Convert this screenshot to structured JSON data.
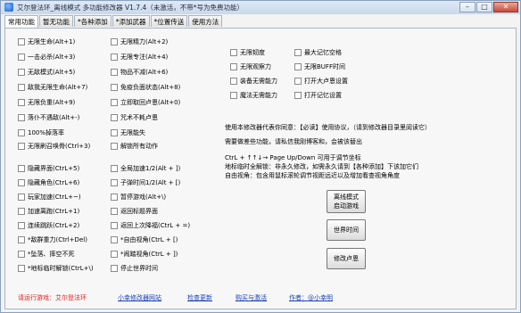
{
  "window": {
    "title": "艾尔登法环_离线模式 多功能修改器 V1.7.4（未激活，不带*号为免费功能）",
    "minimize": "–",
    "maximize": "□",
    "close": "✕"
  },
  "tabs": [
    "常用功能",
    "暂无功能",
    "*各种添加",
    "*添加武器",
    "*位置传送",
    "使用方法"
  ],
  "col1": [
    "无限生命(Alt+1)",
    "一击必杀(Alt+3)",
    "无敌模式(Alt+5)",
    "敌我无限生命(Alt+7)",
    "无限负重(Alt+9)",
    "落仆不遇敌(Alt+-)",
    "100%掉落率",
    "无限刷召唤骨(Ctrl+3)",
    "隐藏界面(CtrL+5)",
    "隐藏角色(CtrL+6)",
    "玩家加速(CtrL+~)",
    "加速离跑(CtrL+1)",
    "连续跳跃(CtrL+2)",
    "*敌群重力(Ctrl+Del)",
    "*坠落、摔空不死",
    "*地标临时解锁(CtrL+\\)"
  ],
  "col2": [
    "无限精力(Alt+2)",
    "无限专注(Alt+4)",
    "物品不减(Alt+6)",
    "免疫负面状态(Alt+8)",
    "立即取回卢恩(Alt+0)",
    "咒术不耗卢恩",
    "无限能失",
    "解锁所有动作",
    "全局加速1/2(Alt + ])",
    "子弹时间1/2(Alt + [)",
    "暂停游戏(Alt+\\)",
    "返回标题界面",
    "返回上次降福(CtrL + =)",
    "*自由视角(CtrL + [)",
    "*闹踏视角(CtrL + ])",
    "停止世界时间"
  ],
  "col3": [
    "无限韧度",
    "无限观察力",
    "装备无需能力",
    "魔法无需能力"
  ],
  "col4": [
    "最大记忆空格",
    "无限BUFF时间",
    "打开大卢恩设置",
    "打开记忆设置"
  ],
  "info": {
    "line1": "使用本修改器代表你同意：【必读】使用协议，（请到修改器目录里阅读它）",
    "line2": "需要做差些功能，请私信我刚博客和，会被该替出",
    "line3": "CtrL + ↑↑↓→ Page Up/Down 可用于调节坐标",
    "line4": "地标临时全解锁：非永久修改，如需永久请到【各种添加】下该加它们",
    "line5": "自由视角：包含用鼠标滚轮调节视距远近以及增加看查视角角度"
  },
  "buttons": {
    "offline_line1": "离线模式",
    "offline_line2": "启动游戏",
    "world_time": "世界时间",
    "edit_runes": "修改卢恩"
  },
  "bottom": {
    "status": "请运行游戏：艾尔登法环",
    "link1": "小幸修改器网站",
    "link2": "检查更新",
    "link3": "购买与激活",
    "link4": "作者：@小幸明"
  }
}
